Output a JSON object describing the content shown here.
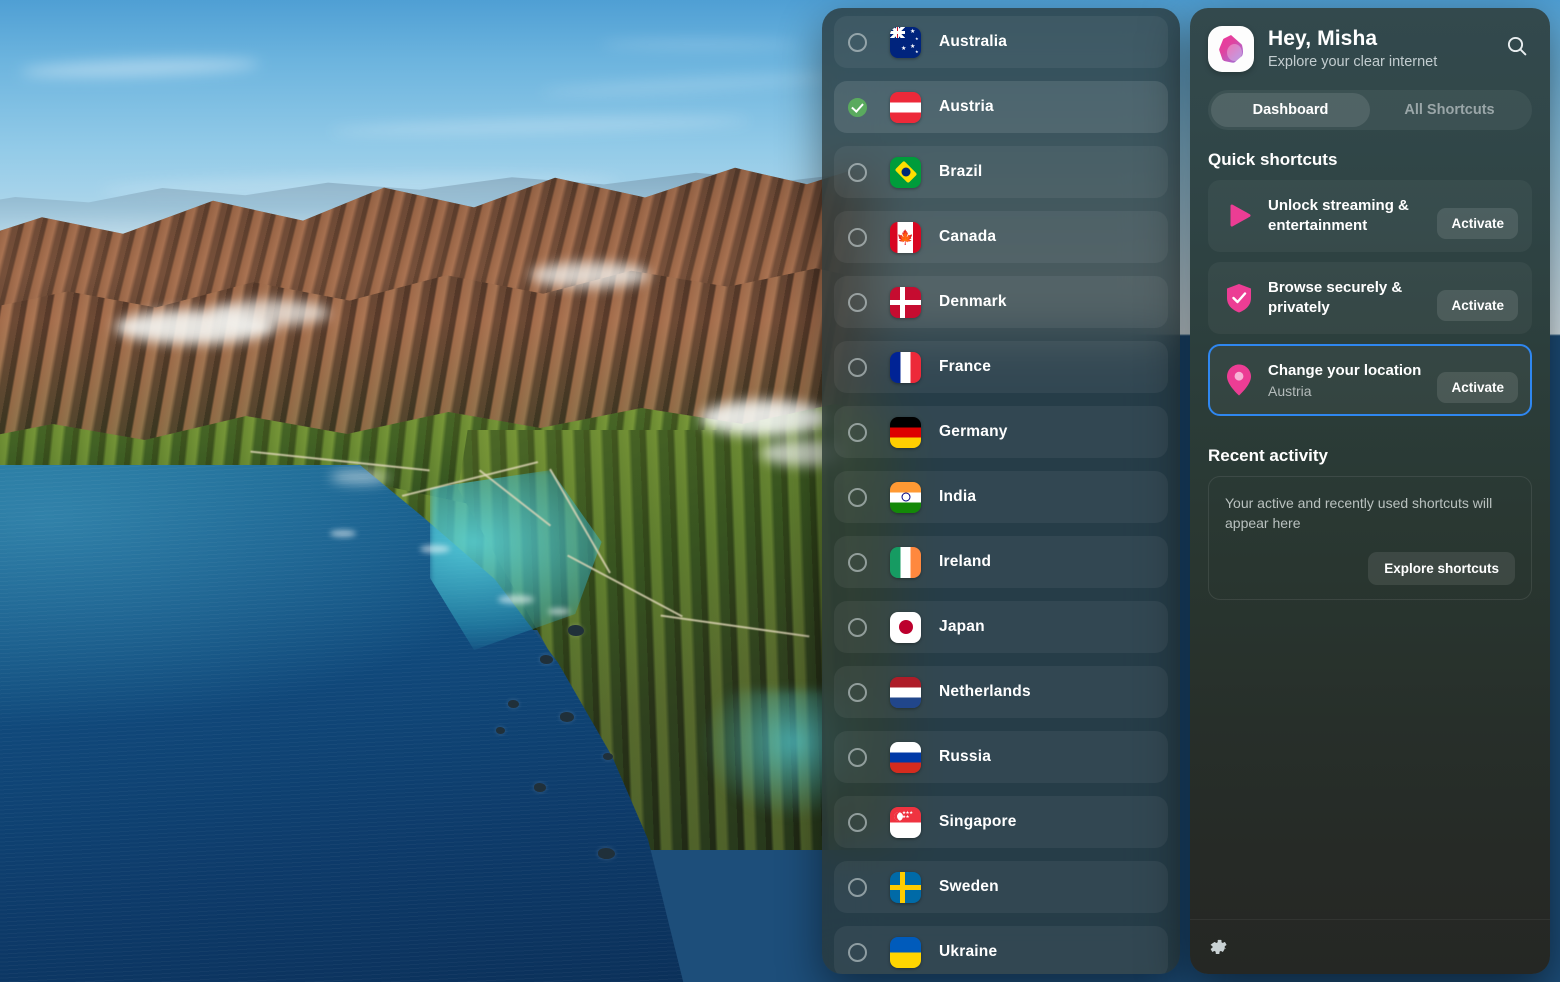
{
  "wallpaper": {
    "name": "big-sur-coastline",
    "description": "Aerial photo of Big Sur coastline with blue sky, brown ridges, green hills and deep blue ocean"
  },
  "country_list": {
    "name": "country-selector",
    "selected_country": "Austria",
    "countries": [
      {
        "name": "Australia",
        "code": "au",
        "selected": false
      },
      {
        "name": "Austria",
        "code": "at",
        "selected": true
      },
      {
        "name": "Brazil",
        "code": "br",
        "selected": false
      },
      {
        "name": "Canada",
        "code": "ca",
        "selected": false
      },
      {
        "name": "Denmark",
        "code": "dk",
        "selected": false
      },
      {
        "name": "France",
        "code": "fr",
        "selected": false
      },
      {
        "name": "Germany",
        "code": "de",
        "selected": false
      },
      {
        "name": "India",
        "code": "in",
        "selected": false
      },
      {
        "name": "Ireland",
        "code": "ie",
        "selected": false
      },
      {
        "name": "Japan",
        "code": "jp",
        "selected": false
      },
      {
        "name": "Netherlands",
        "code": "nl",
        "selected": false
      },
      {
        "name": "Russia",
        "code": "ru",
        "selected": false
      },
      {
        "name": "Singapore",
        "code": "sg",
        "selected": false
      },
      {
        "name": "Sweden",
        "code": "se",
        "selected": false
      },
      {
        "name": "Ukraine",
        "code": "ua",
        "selected": false
      }
    ]
  },
  "app": {
    "header": {
      "greeting": "Hey, Misha",
      "tagline": "Explore your clear internet",
      "logo_icon": "droplet-logo-icon",
      "search_icon": "search-icon"
    },
    "tabs": [
      {
        "label": "Dashboard",
        "active": true
      },
      {
        "label": "All Shortcuts",
        "active": false
      }
    ],
    "quick_shortcuts": {
      "title": "Quick shortcuts",
      "items": [
        {
          "title": "Unlock streaming & entertainment",
          "subtitle": "",
          "icon": "play-triangle-icon",
          "button": "Activate",
          "highlighted": false
        },
        {
          "title": "Browse securely & privately",
          "subtitle": "",
          "icon": "shield-check-icon",
          "button": "Activate",
          "highlighted": false
        },
        {
          "title": "Change your location",
          "subtitle": "Austria",
          "icon": "location-pin-icon",
          "button": "Activate",
          "highlighted": true
        }
      ]
    },
    "recent_activity": {
      "title": "Recent activity",
      "empty_text": "Your active and recently used shortcuts will appear here",
      "explore_button": "Explore shortcuts"
    },
    "footer": {
      "settings_icon": "gear-icon"
    },
    "colors": {
      "accent_pink": "#ec3d94",
      "highlight_blue": "#2f87f0",
      "selected_green": "#5aaa5e",
      "panel_top": "#33494d",
      "panel_bottom": "#262a26"
    }
  }
}
